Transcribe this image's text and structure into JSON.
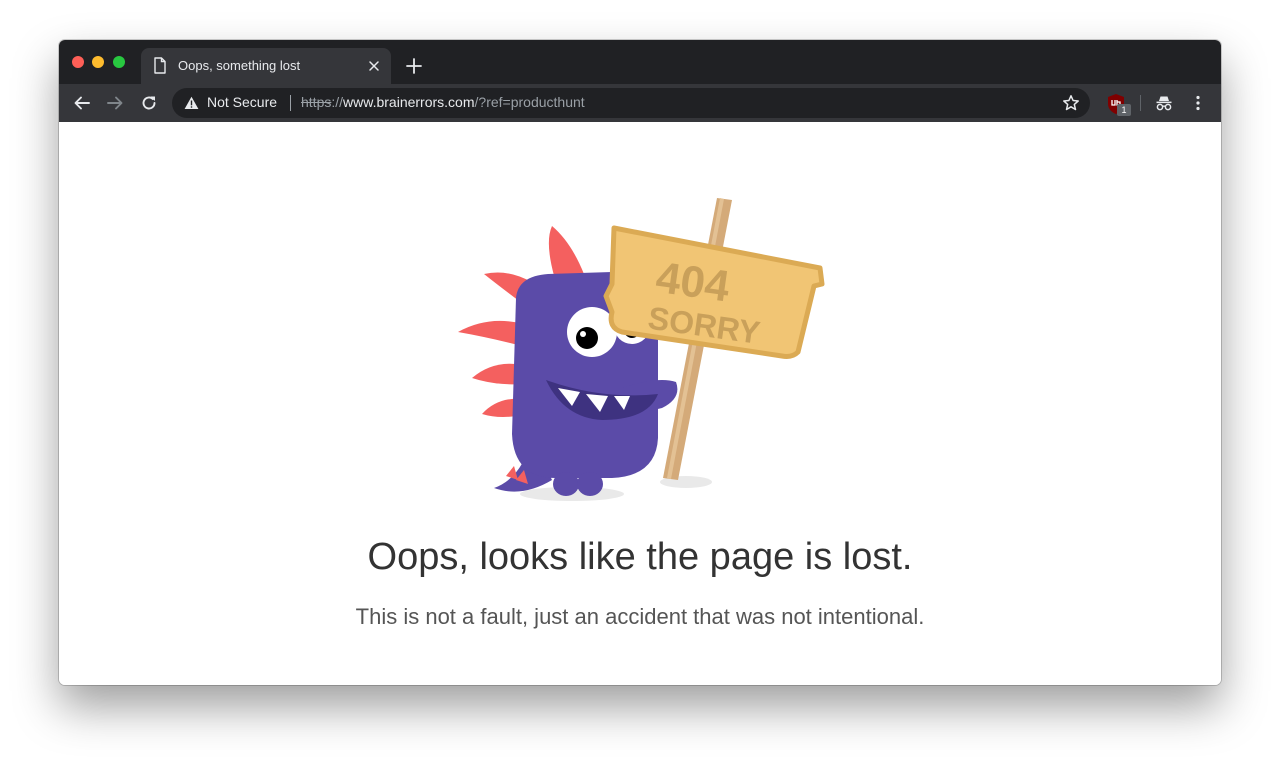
{
  "browser": {
    "tab": {
      "title": "Oops, something lost"
    },
    "omnibox": {
      "security_label": "Not Secure",
      "url_scheme": "https",
      "url_separator": "://",
      "url_host": "www.brainerrors.com",
      "url_path": "/?ref=producthunt"
    },
    "extensions": {
      "ublock_badge": "1"
    }
  },
  "page": {
    "sign_line1": "404",
    "sign_line2": "SORRY",
    "headline": "Oops, looks like the page is lost.",
    "subline": "This is not a fault, just an accident that was not intentional."
  },
  "colors": {
    "titlebar": "#202124",
    "toolbar": "#35363a",
    "monster": "#5b4ba8",
    "spikes": "#f4605f",
    "sign": "#f1c574",
    "pole": "#d4aa79"
  },
  "icons": [
    "document-icon",
    "close-tab-icon",
    "plus-icon",
    "back-arrow-icon",
    "forward-arrow-icon",
    "reload-icon",
    "warning-icon",
    "star-icon",
    "ublock-icon",
    "incognito-icon",
    "kebab-menu-icon"
  ]
}
